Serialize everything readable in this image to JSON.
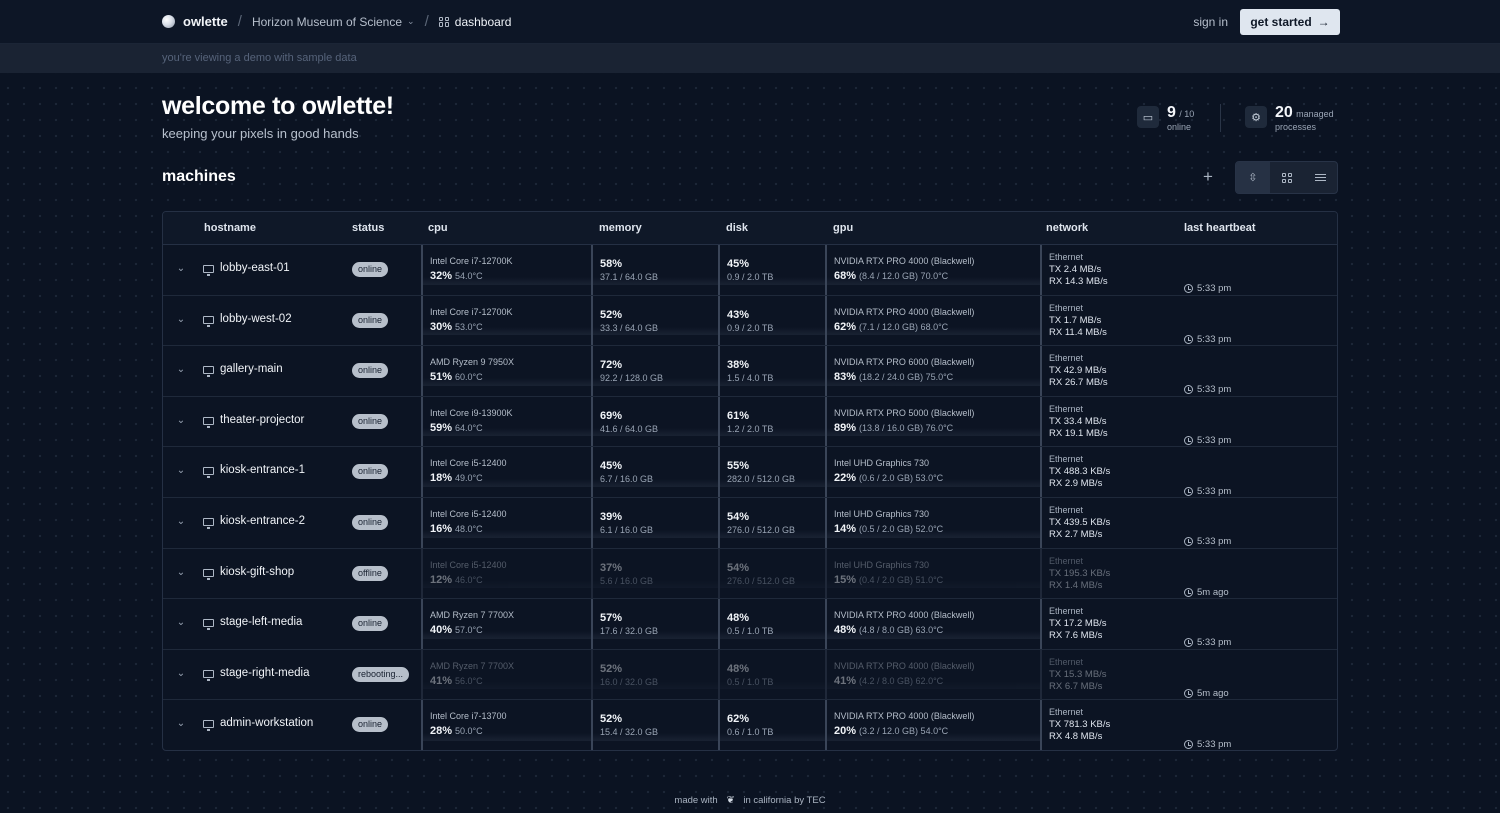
{
  "header": {
    "brand": "owlette",
    "org": "Horizon Museum of Science",
    "crumb": "dashboard",
    "signin": "sign in",
    "cta": "get started"
  },
  "banner": "you're viewing a demo with sample data",
  "hero": {
    "title": "welcome to owlette!",
    "subtitle": "keeping your pixels in good hands"
  },
  "stats": {
    "online_count": "9",
    "online_total": "/ 10",
    "online_label": "online",
    "processes_count": "20",
    "processes_label1": "managed",
    "processes_label2": "processes"
  },
  "machines": {
    "title": "machines",
    "columns": [
      "hostname",
      "status",
      "cpu",
      "memory",
      "disk",
      "gpu",
      "network",
      "last heartbeat"
    ],
    "rows": [
      {
        "host": "lobby-east-01",
        "status": "online",
        "cpu_name": "Intel Core i7-12700K",
        "cpu_pct": "32%",
        "cpu_temp": "54.0°C",
        "mem_pct": "58%",
        "mem_detail": "37.1 / 64.0 GB",
        "disk_pct": "45%",
        "disk_detail": "0.9 / 2.0 TB",
        "gpu_name": "NVIDIA RTX PRO 4000 (Blackwell)",
        "gpu_pct": "68%",
        "gpu_detail": "(8.4 / 12.0 GB) 70.0°C",
        "net_type": "Ethernet",
        "tx": "TX 2.4 MB/s",
        "rx": "RX 14.3 MB/s",
        "hb": "5:33 pm",
        "dim": false
      },
      {
        "host": "lobby-west-02",
        "status": "online",
        "cpu_name": "Intel Core i7-12700K",
        "cpu_pct": "30%",
        "cpu_temp": "53.0°C",
        "mem_pct": "52%",
        "mem_detail": "33.3 / 64.0 GB",
        "disk_pct": "43%",
        "disk_detail": "0.9 / 2.0 TB",
        "gpu_name": "NVIDIA RTX PRO 4000 (Blackwell)",
        "gpu_pct": "62%",
        "gpu_detail": "(7.1 / 12.0 GB) 68.0°C",
        "net_type": "Ethernet",
        "tx": "TX 1.7 MB/s",
        "rx": "RX 11.4 MB/s",
        "hb": "5:33 pm",
        "dim": false
      },
      {
        "host": "gallery-main",
        "status": "online",
        "cpu_name": "AMD Ryzen 9 7950X",
        "cpu_pct": "51%",
        "cpu_temp": "60.0°C",
        "mem_pct": "72%",
        "mem_detail": "92.2 / 128.0 GB",
        "disk_pct": "38%",
        "disk_detail": "1.5 / 4.0 TB",
        "gpu_name": "NVIDIA RTX PRO 6000 (Blackwell)",
        "gpu_pct": "83%",
        "gpu_detail": "(18.2 / 24.0 GB) 75.0°C",
        "net_type": "Ethernet",
        "tx": "TX 42.9 MB/s",
        "rx": "RX 26.7 MB/s",
        "hb": "5:33 pm",
        "dim": false
      },
      {
        "host": "theater-projector",
        "status": "online",
        "cpu_name": "Intel Core i9-13900K",
        "cpu_pct": "59%",
        "cpu_temp": "64.0°C",
        "mem_pct": "69%",
        "mem_detail": "41.6 / 64.0 GB",
        "disk_pct": "61%",
        "disk_detail": "1.2 / 2.0 TB",
        "gpu_name": "NVIDIA RTX PRO 5000 (Blackwell)",
        "gpu_pct": "89%",
        "gpu_detail": "(13.8 / 16.0 GB) 76.0°C",
        "net_type": "Ethernet",
        "tx": "TX 33.4 MB/s",
        "rx": "RX 19.1 MB/s",
        "hb": "5:33 pm",
        "dim": false
      },
      {
        "host": "kiosk-entrance-1",
        "status": "online",
        "cpu_name": "Intel Core i5-12400",
        "cpu_pct": "18%",
        "cpu_temp": "49.0°C",
        "mem_pct": "45%",
        "mem_detail": "6.7 / 16.0 GB",
        "disk_pct": "55%",
        "disk_detail": "282.0 / 512.0 GB",
        "gpu_name": "Intel UHD Graphics 730",
        "gpu_pct": "22%",
        "gpu_detail": "(0.6 / 2.0 GB) 53.0°C",
        "net_type": "Ethernet",
        "tx": "TX 488.3 KB/s",
        "rx": "RX 2.9 MB/s",
        "hb": "5:33 pm",
        "dim": false
      },
      {
        "host": "kiosk-entrance-2",
        "status": "online",
        "cpu_name": "Intel Core i5-12400",
        "cpu_pct": "16%",
        "cpu_temp": "48.0°C",
        "mem_pct": "39%",
        "mem_detail": "6.1 / 16.0 GB",
        "disk_pct": "54%",
        "disk_detail": "276.0 / 512.0 GB",
        "gpu_name": "Intel UHD Graphics 730",
        "gpu_pct": "14%",
        "gpu_detail": "(0.5 / 2.0 GB) 52.0°C",
        "net_type": "Ethernet",
        "tx": "TX 439.5 KB/s",
        "rx": "RX 2.7 MB/s",
        "hb": "5:33 pm",
        "dim": false
      },
      {
        "host": "kiosk-gift-shop",
        "status": "offline",
        "cpu_name": "Intel Core i5-12400",
        "cpu_pct": "12%",
        "cpu_temp": "46.0°C",
        "mem_pct": "37%",
        "mem_detail": "5.6 / 16.0 GB",
        "disk_pct": "54%",
        "disk_detail": "276.0 / 512.0 GB",
        "gpu_name": "Intel UHD Graphics 730",
        "gpu_pct": "15%",
        "gpu_detail": "(0.4 / 2.0 GB) 51.0°C",
        "net_type": "Ethernet",
        "tx": "TX 195.3 KB/s",
        "rx": "RX 1.4 MB/s",
        "hb": "5m ago",
        "dim": true
      },
      {
        "host": "stage-left-media",
        "status": "online",
        "cpu_name": "AMD Ryzen 7 7700X",
        "cpu_pct": "40%",
        "cpu_temp": "57.0°C",
        "mem_pct": "57%",
        "mem_detail": "17.6 / 32.0 GB",
        "disk_pct": "48%",
        "disk_detail": "0.5 / 1.0 TB",
        "gpu_name": "NVIDIA RTX PRO 4000 (Blackwell)",
        "gpu_pct": "48%",
        "gpu_detail": "(4.8 / 8.0 GB) 63.0°C",
        "net_type": "Ethernet",
        "tx": "TX 17.2 MB/s",
        "rx": "RX 7.6 MB/s",
        "hb": "5:33 pm",
        "dim": false
      },
      {
        "host": "stage-right-media",
        "status": "rebooting...",
        "cpu_name": "AMD Ryzen 7 7700X",
        "cpu_pct": "41%",
        "cpu_temp": "56.0°C",
        "mem_pct": "52%",
        "mem_detail": "16.0 / 32.0 GB",
        "disk_pct": "48%",
        "disk_detail": "0.5 / 1.0 TB",
        "gpu_name": "NVIDIA RTX PRO 4000 (Blackwell)",
        "gpu_pct": "41%",
        "gpu_detail": "(4.2 / 8.0 GB) 62.0°C",
        "net_type": "Ethernet",
        "tx": "TX 15.3 MB/s",
        "rx": "RX 6.7 MB/s",
        "hb": "5m ago",
        "dim": true
      },
      {
        "host": "admin-workstation",
        "status": "online",
        "cpu_name": "Intel Core i7-13700",
        "cpu_pct": "28%",
        "cpu_temp": "50.0°C",
        "mem_pct": "52%",
        "mem_detail": "15.4 / 32.0 GB",
        "disk_pct": "62%",
        "disk_detail": "0.6 / 1.0 TB",
        "gpu_name": "NVIDIA RTX PRO 4000 (Blackwell)",
        "gpu_pct": "20%",
        "gpu_detail": "(3.2 / 12.0 GB) 54.0°C",
        "net_type": "Ethernet",
        "tx": "TX 781.3 KB/s",
        "rx": "RX 4.8 MB/s",
        "hb": "5:33 pm",
        "dim": false
      }
    ]
  },
  "footer": {
    "made_with": "made with",
    "location": "in california by TEC"
  }
}
